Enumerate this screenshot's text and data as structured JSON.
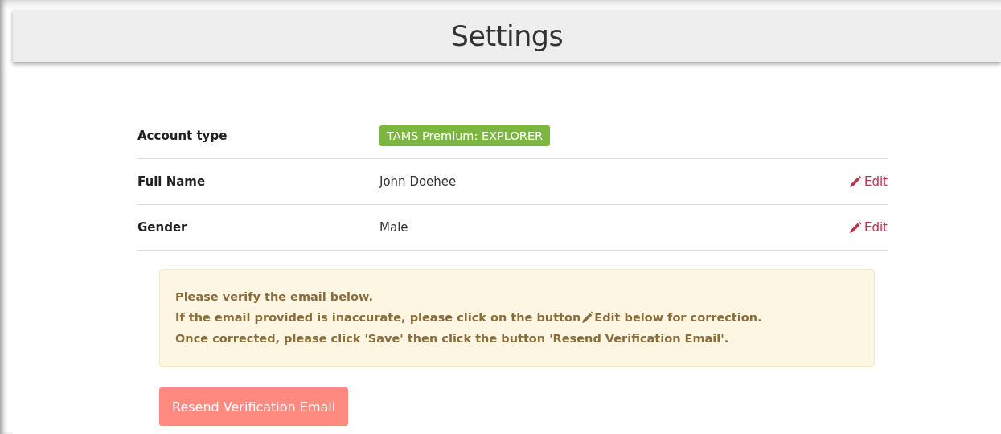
{
  "header": {
    "title": "Settings"
  },
  "rows": [
    {
      "label": "Account type",
      "kind": "badge",
      "value": "TAMS Premium: EXPLORER"
    },
    {
      "label": "Full Name",
      "kind": "text",
      "value": "John Doehee",
      "action": "Edit"
    },
    {
      "label": "Gender",
      "kind": "text",
      "value": "Male",
      "action": "Edit"
    }
  ],
  "alert": {
    "lines": [
      {
        "parts": [
          "Please verify the email below."
        ]
      },
      {
        "parts": [
          "If the email provided is inaccurate, please click on the button",
          "Edit below for correction."
        ]
      },
      {
        "parts": [
          "Once corrected, please click 'Save' then click the button 'Resend Verification Email'."
        ]
      }
    ]
  },
  "resend_button": {
    "label": "Resend Verification Email"
  }
}
